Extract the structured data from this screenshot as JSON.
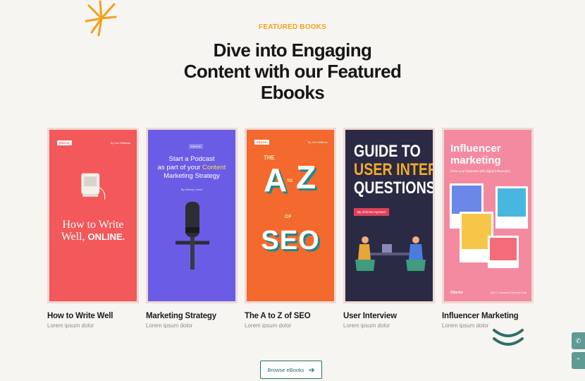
{
  "section": {
    "eyebrow": "FEATURED BOOKS",
    "headline_lines": [
      "Dive into Engaging",
      "Content with our Featured",
      "Ebooks"
    ]
  },
  "books": [
    {
      "title": "How to Write Well",
      "subtitle": "Lorem ipsum dolor",
      "cover": {
        "tag": "EBOOK",
        "author": "By Joe Williams",
        "line1": "How to Write",
        "line2": "Well,",
        "line3": "ONLINE.",
        "color": "#f3585a"
      }
    },
    {
      "title": "Marketing Strategy",
      "subtitle": "Lorem ipsum dolor",
      "cover": {
        "tag": "EBOOK",
        "line1": "Start a Podcast",
        "line2": "as part of your",
        "highlight": "Content",
        "line3": "Marketing Strategy",
        "author": "By Melody Jones",
        "color": "#6b5ce6"
      }
    },
    {
      "title": "The A to Z of SEO",
      "subtitle": "Lorem ipsum dolor",
      "cover": {
        "tag": "EBOOK",
        "author": "By Joe Williams",
        "line1": "THE",
        "big_a": "A",
        "to": "TO",
        "big_z": "Z",
        "of": "OF",
        "seo": "SEO",
        "color": "#f3692e"
      }
    },
    {
      "title": "User Interview",
      "subtitle": "Lorem ipsum dolor",
      "cover": {
        "line1": "GUIDE TO",
        "line2": "USER INTERVIEW",
        "line3": "QUESTIONS",
        "author": "By Abhinav Agrawal",
        "color": "#2b2a44"
      }
    },
    {
      "title": "Influencer Marketing",
      "subtitle": "Lorem ipsum dolor",
      "cover": {
        "line1": "Influencer",
        "line2": "marketing",
        "tagline": "Grow your business with digital influencers",
        "brand": "Oberlo",
        "author": "By P.J. Lemmon & Amanda Gold",
        "color": "#f48aa0"
      }
    }
  ],
  "actions": {
    "browse_label": "Browse eBooks",
    "browse_icon": "arrow-right-icon",
    "phone_icon": "phone-icon",
    "up_icon": "arrow-up-icon"
  },
  "colors": {
    "accent": "#f0a31b",
    "teal": "#2a6f6a",
    "background": "#f7f5f1"
  }
}
